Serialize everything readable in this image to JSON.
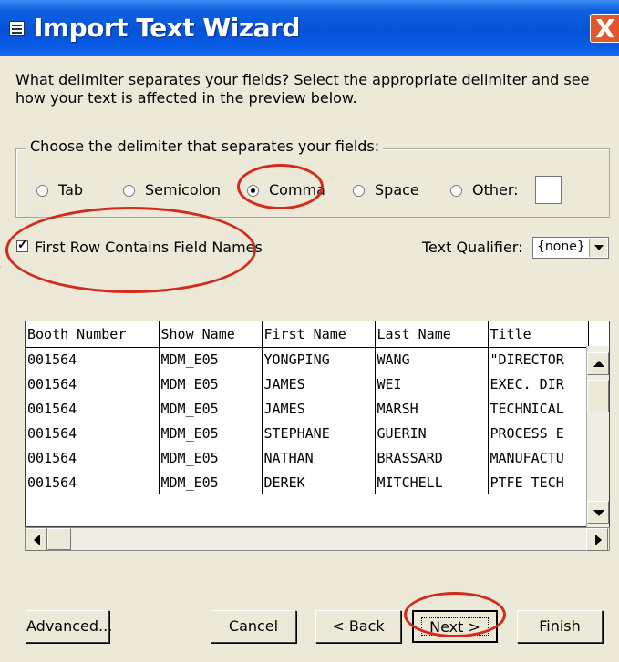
{
  "window": {
    "title": "Import Text Wizard",
    "close_label": "X"
  },
  "intro_text": "What delimiter separates your fields? Select the appropriate delimiter and see how your text is affected in the preview below.",
  "delimiter_group": {
    "legend": "Choose the delimiter that separates your fields:",
    "options": [
      {
        "label": "Tab",
        "selected": false
      },
      {
        "label": "Semicolon",
        "selected": false
      },
      {
        "label": "Comma",
        "selected": true
      },
      {
        "label": "Space",
        "selected": false
      },
      {
        "label": "Other:",
        "selected": false
      }
    ],
    "other_value": ""
  },
  "first_row": {
    "label": "First Row Contains Field Names",
    "checked": true
  },
  "text_qualifier": {
    "label": "Text Qualifier:",
    "value": "{none}"
  },
  "preview": {
    "columns": [
      "Booth Number",
      "Show Name",
      "First Name",
      "Last Name",
      "Title"
    ],
    "rows": [
      [
        "001564",
        "MDM_E05",
        "YONGPING",
        "WANG",
        "\"DIRECTOR"
      ],
      [
        "001564",
        "MDM_E05",
        "JAMES",
        "WEI",
        "EXEC. DIR"
      ],
      [
        "001564",
        "MDM_E05",
        "JAMES",
        "MARSH",
        "TECHNICAL"
      ],
      [
        "001564",
        "MDM_E05",
        "STEPHANE",
        "GUERIN",
        "PROCESS E"
      ],
      [
        "001564",
        "MDM_E05",
        "NATHAN",
        "BRASSARD",
        "MANUFACTU"
      ],
      [
        "001564",
        "MDM_E05",
        "DEREK",
        "MITCHELL",
        "PTFE TECH"
      ]
    ]
  },
  "buttons": {
    "advanced": "Advanced...",
    "cancel": "Cancel",
    "back": "< Back",
    "next": "Next >",
    "finish": "Finish"
  },
  "colors": {
    "title_bar": "#0553d8",
    "annotation": "#d42a1c",
    "dialog_bg": "#ece9d8"
  }
}
